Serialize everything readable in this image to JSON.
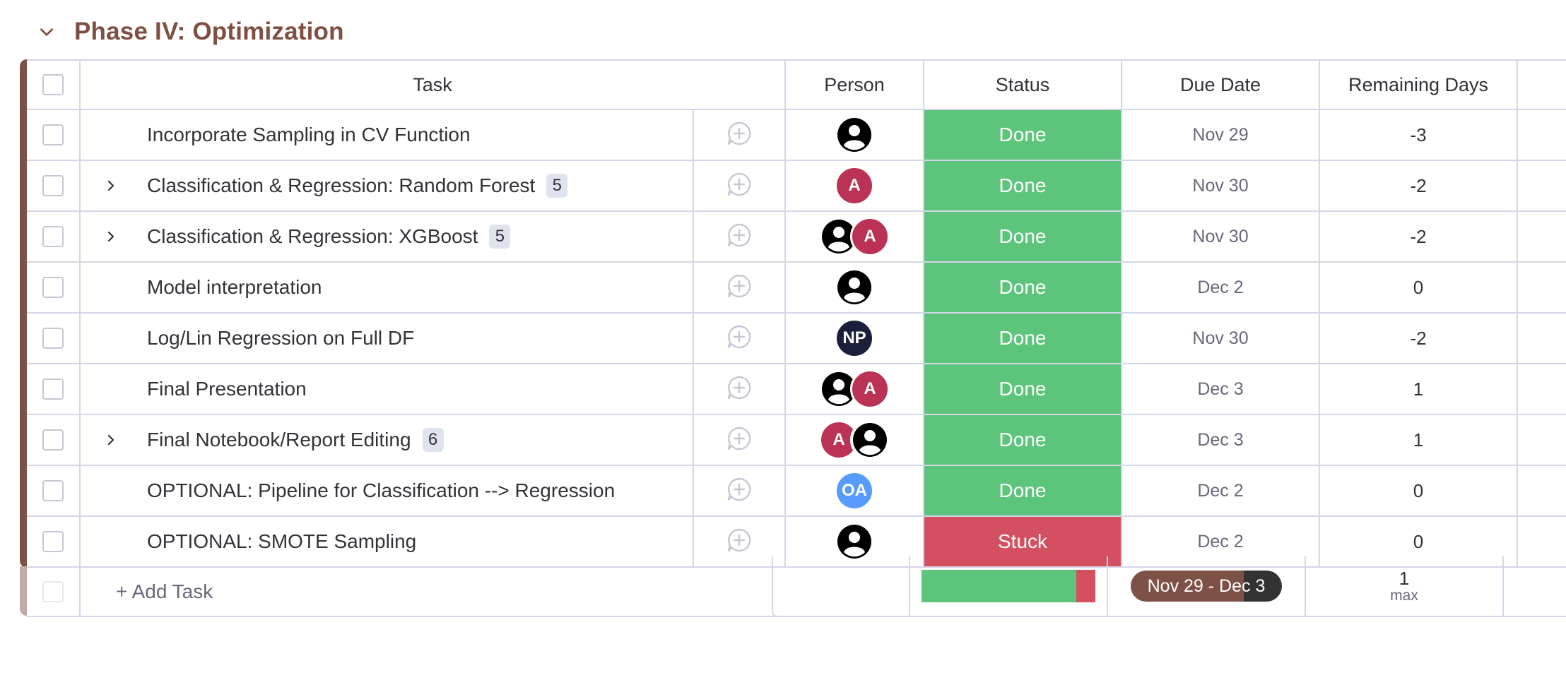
{
  "group": {
    "title": "Phase IV: Optimization",
    "color": "#7e5146"
  },
  "columns": {
    "task": "Task",
    "person": "Person",
    "status": "Status",
    "due_date": "Due Date",
    "remaining_days": "Remaining Days"
  },
  "rows": [
    {
      "task": "Incorporate Sampling in CV Function",
      "subitems": "",
      "people": [
        "user-icon"
      ],
      "status": "Done",
      "status_color": "#5cc57b",
      "due": "Nov 29",
      "remaining": "-3"
    },
    {
      "task": "Classification & Regression: Random Forest",
      "subitems": "5",
      "people": [
        "A"
      ],
      "status": "Done",
      "status_color": "#5cc57b",
      "due": "Nov 30",
      "remaining": "-2"
    },
    {
      "task": "Classification & Regression: XGBoost",
      "subitems": "5",
      "people": [
        "user-icon",
        "A"
      ],
      "status": "Done",
      "status_color": "#5cc57b",
      "due": "Nov 30",
      "remaining": "-2"
    },
    {
      "task": "Model interpretation",
      "subitems": "",
      "people": [
        "user-icon"
      ],
      "status": "Done",
      "status_color": "#5cc57b",
      "due": "Dec 2",
      "remaining": "0"
    },
    {
      "task": "Log/Lin Regression on Full DF",
      "subitems": "",
      "people": [
        "NP"
      ],
      "status": "Done",
      "status_color": "#5cc57b",
      "due": "Nov 30",
      "remaining": "-2"
    },
    {
      "task": "Final Presentation",
      "subitems": "",
      "people": [
        "user-icon",
        "A"
      ],
      "status": "Done",
      "status_color": "#5cc57b",
      "due": "Dec 3",
      "remaining": "1"
    },
    {
      "task": "Final Notebook/Report Editing",
      "subitems": "6",
      "people": [
        "A",
        "user-icon"
      ],
      "status": "Done",
      "status_color": "#5cc57b",
      "due": "Dec 3",
      "remaining": "1"
    },
    {
      "task": "OPTIONAL: Pipeline for Classification --> Regression",
      "subitems": "",
      "people": [
        "OA"
      ],
      "status": "Done",
      "status_color": "#5cc57b",
      "due": "Dec 2",
      "remaining": "0"
    },
    {
      "task": "OPTIONAL: SMOTE Sampling",
      "subitems": "",
      "people": [
        "user-icon"
      ],
      "status": "Stuck",
      "status_color": "#d44f5f",
      "due": "Dec 2",
      "remaining": "0"
    }
  ],
  "add_task_label": "+ Add Task",
  "summary": {
    "status_distribution": [
      {
        "label": "Done",
        "fraction": 0.889,
        "color": "#5cc57b"
      },
      {
        "label": "Stuck",
        "fraction": 0.111,
        "color": "#d44f5f"
      }
    ],
    "date_range": "Nov 29 - Dec 3",
    "remaining_value": "1",
    "remaining_label": "max"
  }
}
